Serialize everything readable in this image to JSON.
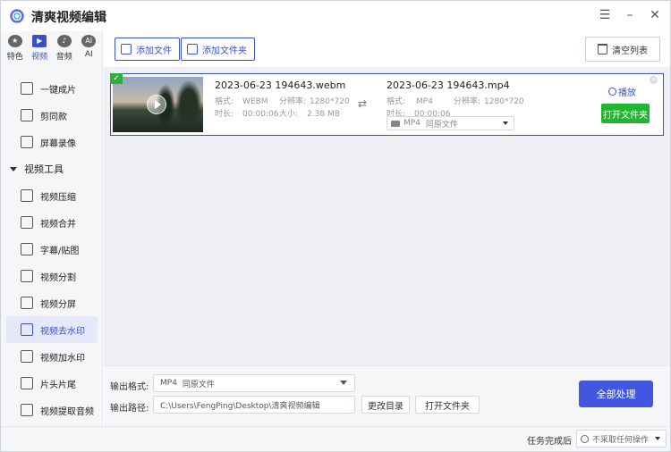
{
  "app": {
    "title": "清爽视频编辑"
  },
  "top_tabs": [
    {
      "label": "特色",
      "icon": "star-icon",
      "glyph": "★"
    },
    {
      "label": "视频",
      "icon": "film-icon",
      "glyph": "▶"
    },
    {
      "label": "音频",
      "icon": "music-icon",
      "glyph": "♪"
    },
    {
      "label": "AI",
      "icon": "ai-icon",
      "glyph": "AI"
    }
  ],
  "sidebar": {
    "items_top": [
      {
        "label": "一键成片",
        "icon": "quick-make-icon"
      },
      {
        "label": "剪同款",
        "icon": "template-icon"
      },
      {
        "label": "屏幕录像",
        "icon": "screen-record-icon"
      }
    ],
    "group_label": "视频工具",
    "tools": [
      {
        "label": "视频压缩",
        "icon": "compress-icon"
      },
      {
        "label": "视频合并",
        "icon": "merge-icon"
      },
      {
        "label": "字幕/贴图",
        "icon": "subtitle-icon"
      },
      {
        "label": "视频分割",
        "icon": "split-icon"
      },
      {
        "label": "视频分屏",
        "icon": "split-screen-icon"
      },
      {
        "label": "视频去水印",
        "icon": "remove-watermark-icon",
        "active": true
      },
      {
        "label": "视频加水印",
        "icon": "add-watermark-icon"
      },
      {
        "label": "片头片尾",
        "icon": "intro-outro-icon"
      },
      {
        "label": "视频提取音频",
        "icon": "extract-audio-icon"
      }
    ]
  },
  "toolbar": {
    "add_file": "添加文件",
    "add_folder": "添加文件夹",
    "clear_list": "清空列表"
  },
  "file": {
    "source": {
      "name": "2023-06-23 194643.webm",
      "format_label": "格式:",
      "format": "WEBM",
      "resolution_label": "分辨率:",
      "resolution": "1280*720",
      "duration_label": "时长:",
      "duration": "00:00:06",
      "size_label": "大小:",
      "size": "2.38 MB"
    },
    "output": {
      "name": "2023-06-23 194643.mp4",
      "format_label": "格式:",
      "format": "MP4",
      "resolution_label": "分辨率:",
      "resolution": "1280*720",
      "duration_label": "时长:",
      "duration": "00:00:06",
      "select_format": "MP4",
      "select_quality": "同原文件"
    },
    "play": "播放",
    "open_folder": "打开文件夹"
  },
  "output_panel": {
    "format_label": "输出格式:",
    "format_value": "MP4",
    "format_quality": "同原文件",
    "path_label": "输出路径:",
    "path_value": "C:\\Users\\FengPing\\Desktop\\清爽视频编辑",
    "change_dir": "更改目录",
    "open_folder": "打开文件夹",
    "process_all": "全部处理"
  },
  "status": {
    "label": "任务完成后",
    "value": "不采取任何操作"
  },
  "colors": {
    "accent": "#3a52c9",
    "green": "#21b62f",
    "primary_button": "#4356e0"
  }
}
